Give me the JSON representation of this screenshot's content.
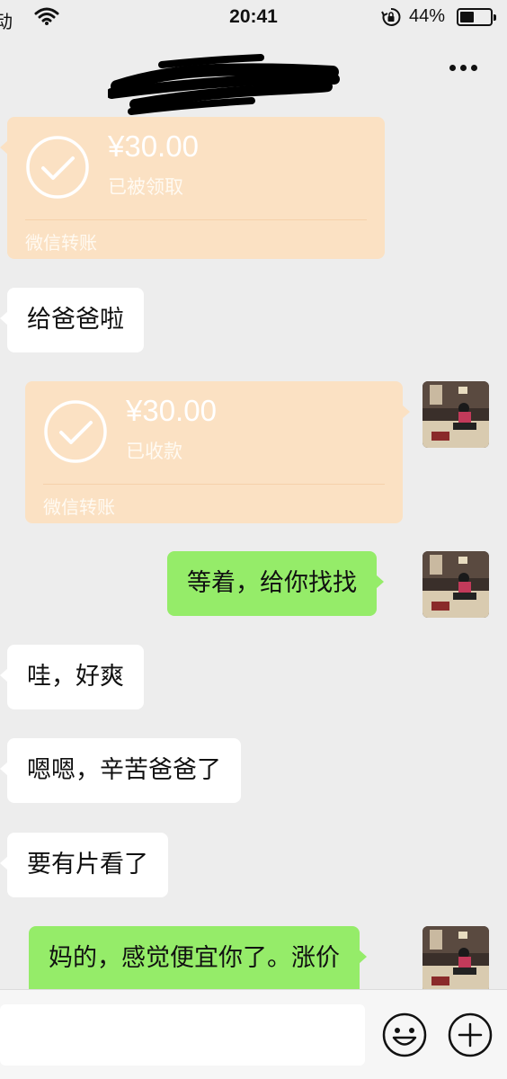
{
  "status_bar": {
    "carrier": "动",
    "time": "20:41",
    "battery_percent": "44%",
    "battery_level": 0.44,
    "icons": [
      "wifi-icon",
      "orientation-lock-icon",
      "battery-icon"
    ]
  },
  "nav": {
    "title_redacted": true,
    "more_icon": "more-dots-icon"
  },
  "messages": [
    {
      "type": "transfer",
      "side": "left",
      "amount": "¥30.00",
      "status": "已被领取",
      "brand": "微信转账"
    },
    {
      "type": "text",
      "side": "left",
      "text": "给爸爸啦"
    },
    {
      "type": "transfer",
      "side": "right",
      "amount": "¥30.00",
      "status": "已收款",
      "brand": "微信转账"
    },
    {
      "type": "text",
      "side": "right",
      "text": "等着，给你找找"
    },
    {
      "type": "text",
      "side": "left",
      "text": "哇，好爽"
    },
    {
      "type": "text",
      "side": "left",
      "text": "嗯嗯，辛苦爸爸了"
    },
    {
      "type": "text",
      "side": "left",
      "text": "要有片看了"
    },
    {
      "type": "text",
      "side": "right",
      "text": "妈的，感觉便宜你了。涨价"
    }
  ],
  "input_bar": {
    "placeholder": "",
    "emoji_icon": "emoji-smile-icon",
    "plus_icon": "plus-circle-icon"
  },
  "colors": {
    "background": "#ededed",
    "bubble_in": "#ffffff",
    "bubble_out": "#95ec69",
    "transfer_card": "#fbe1c3"
  }
}
